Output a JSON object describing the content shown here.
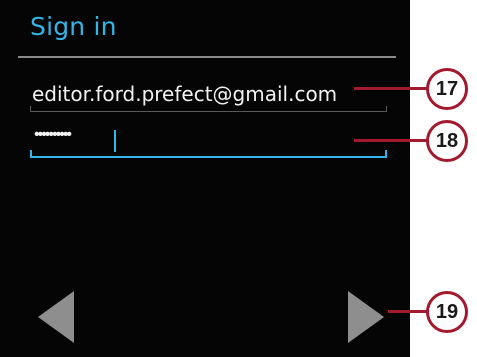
{
  "signin": {
    "title": "Sign in",
    "email_value": "editor.ford.prefect@gmail.com",
    "password_mask": "••••••••••",
    "accent_color": "#33b5e5"
  },
  "navigation": {
    "prev_icon": "triangle-left-icon",
    "next_icon": "triangle-right-icon"
  },
  "callouts": {
    "email": "17",
    "password": "18",
    "next": "19",
    "color": "#a3192d"
  }
}
